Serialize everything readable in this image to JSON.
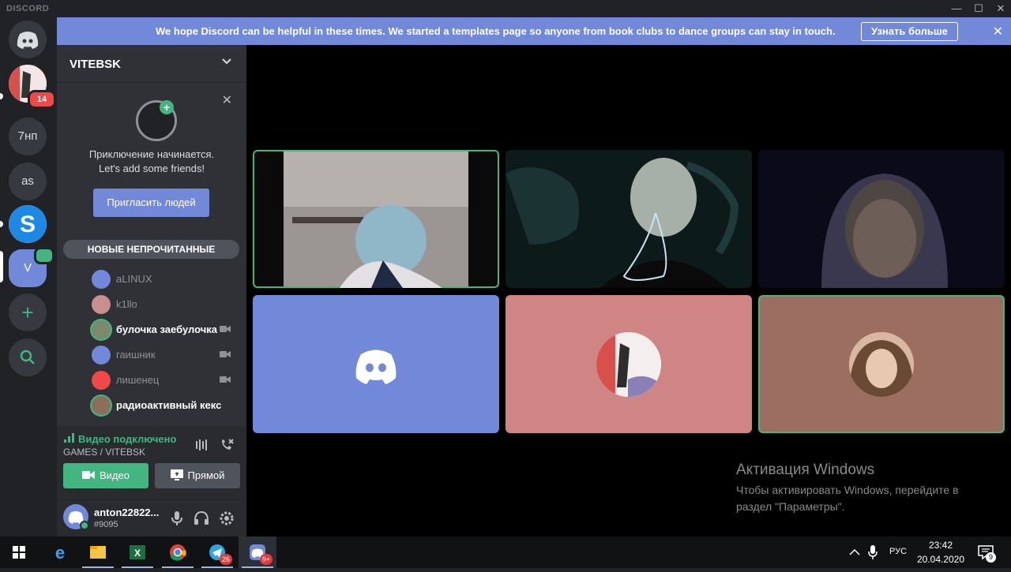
{
  "window": {
    "brand": "DISCORD",
    "controls": {
      "minimize": "—",
      "maximize": "☐",
      "close": "✕"
    }
  },
  "notice": {
    "text": "We hope Discord can be helpful in these times. We started a templates page so anyone from book clubs to dance groups can stay in touch.",
    "button": "Узнать больше",
    "close": "✕"
  },
  "servers": [
    {
      "label": "",
      "icon": "discord-home-icon"
    },
    {
      "label": "",
      "badge": "14"
    },
    {
      "label": "7нп"
    },
    {
      "label": "as"
    },
    {
      "label": "S"
    },
    {
      "label": "V",
      "active": true
    },
    {
      "label": "+",
      "icon": "add-server-icon"
    },
    {
      "label": "",
      "icon": "explore-icon"
    }
  ],
  "guild": {
    "name": "VITEBSK",
    "chevron": "⌄"
  },
  "welcome": {
    "line1": "Приключение начинается.",
    "line2": "Let's add some friends!",
    "button": "Пригласить людей",
    "close": "✕"
  },
  "unread_pill": "НОВЫЕ НЕПРОЧИТАННЫЕ",
  "voice_users": [
    {
      "name": "aLINUX",
      "bright": false,
      "cam": false,
      "color": "#7289da"
    },
    {
      "name": "k1llo",
      "bright": false,
      "cam": false,
      "color": "#c98f8f"
    },
    {
      "name": "булочка заебулочка",
      "bright": true,
      "cam": true,
      "color": "#7a8a6a"
    },
    {
      "name": "гаишник",
      "bright": false,
      "cam": true,
      "color": "#7289da"
    },
    {
      "name": "лишенец",
      "bright": false,
      "cam": true,
      "color": "#f04747"
    },
    {
      "name": "радиоактивный кекс",
      "bright": true,
      "cam": false,
      "color": "#8a6f5a"
    }
  ],
  "voice_panel": {
    "status": "Видео подключено",
    "channel": "GAMES / VITEBSK",
    "video_button": "Видео",
    "live_button": "Прямой"
  },
  "user": {
    "name": "anton22822...",
    "tag": "#9095"
  },
  "tiles": [
    {
      "kind": "video",
      "speaking": true,
      "bg": "#9b9594"
    },
    {
      "kind": "video",
      "speaking": false,
      "bg": "#0c1a1a"
    },
    {
      "kind": "video",
      "speaking": false,
      "bg": "#0a0a18"
    },
    {
      "kind": "avatar",
      "speaking": false,
      "bg": "#7289da"
    },
    {
      "kind": "avatar",
      "speaking": false,
      "bg": "#cf8583"
    },
    {
      "kind": "avatar",
      "speaking": true,
      "bg": "#9c6e61"
    }
  ],
  "watermark": {
    "title": "Активация Windows",
    "line1": "Чтобы активировать Windows, перейдите в",
    "line2": "раздел \"Параметры\"."
  },
  "taskbar": {
    "apps": [
      {
        "name": "windows-start-icon"
      },
      {
        "name": "edge-icon"
      },
      {
        "name": "file-explorer-icon"
      },
      {
        "name": "excel-icon"
      },
      {
        "name": "chrome-icon"
      },
      {
        "name": "telegram-icon",
        "badge": "26"
      },
      {
        "name": "discord-taskbar-icon",
        "badge": "9+"
      }
    ],
    "language": "РУС",
    "time": "23:42",
    "date": "20.04.2020",
    "notifications": "9"
  }
}
